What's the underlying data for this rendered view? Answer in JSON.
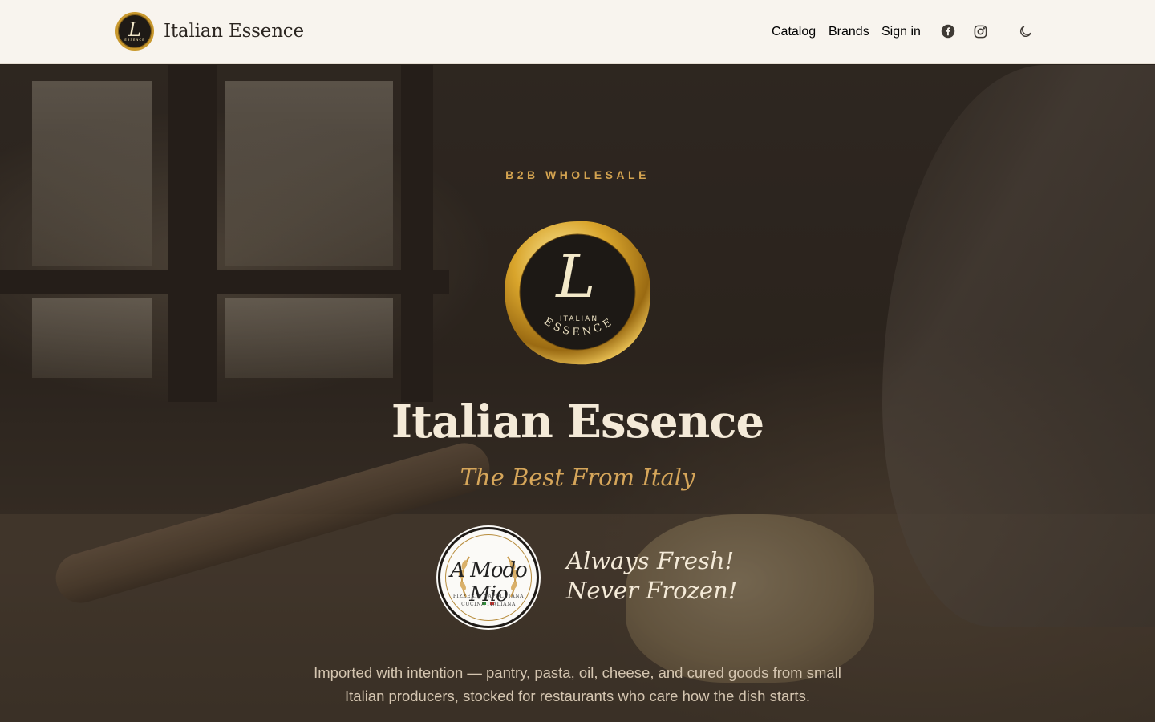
{
  "header": {
    "brand_name": "Italian Essence",
    "logo_letter": "L",
    "logo_sub": "ESSENCE",
    "nav": {
      "catalog": "Catalog",
      "brands": "Brands",
      "sign_in": "Sign in"
    },
    "icons": [
      "facebook-icon",
      "instagram-icon",
      "moon-icon"
    ]
  },
  "hero": {
    "eyebrow": "B2B WHOLESALE",
    "seal": {
      "letter": "L",
      "line1": "ITALIAN",
      "line2": "ESSENCE"
    },
    "title": "Italian Essence",
    "tagline": "The Best From Italy",
    "partner_logo": {
      "name": "A Modo Mio",
      "sub1": "PIZZERIA NAPOLETANA",
      "sub2": "CUCINA ITALIANA"
    },
    "fresh_line1": "Always Fresh!",
    "fresh_line2": "Never Frozen!",
    "description": "Imported with intention — pantry, pasta, oil, cheese, and cured goods from small Italian producers, stocked for restaurants who care how the dish starts."
  },
  "colors": {
    "header_bg": "#f8f4ee",
    "accent_gold": "#d3a350",
    "hero_text": "#f4ead8",
    "tagline": "#d6a65a"
  }
}
